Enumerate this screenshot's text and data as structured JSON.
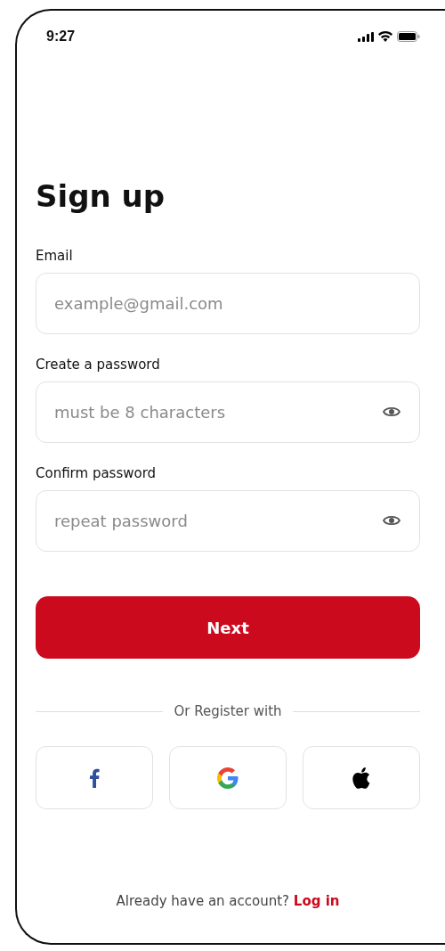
{
  "status_bar": {
    "time": "9:27"
  },
  "title": "Sign up",
  "fields": [
    {
      "kind": "email",
      "label": "Email",
      "placeholder": "example@gmail.com"
    },
    {
      "kind": "password",
      "label": "Create a password",
      "placeholder": "must be 8 characters"
    },
    {
      "kind": "password",
      "label": "Confirm password",
      "placeholder": "repeat password"
    }
  ],
  "primary_button": "Next",
  "divider_text": "Or Register with",
  "social_buttons": [
    {
      "kind": "facebook"
    },
    {
      "kind": "google"
    },
    {
      "kind": "apple"
    }
  ],
  "footer": {
    "text": "Already have an account?",
    "link": "Log in"
  }
}
